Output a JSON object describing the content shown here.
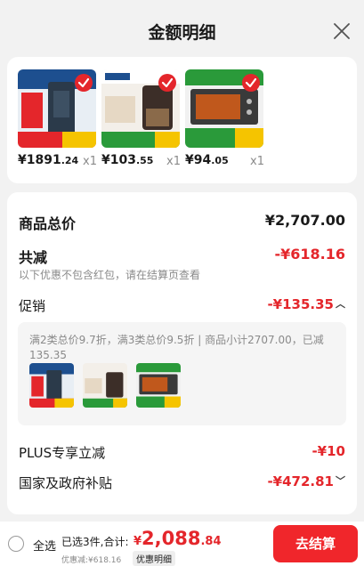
{
  "header": {
    "title": "金额明细"
  },
  "products": [
    {
      "price_int": "¥1891",
      "price_dec": ".24",
      "qty": "x1",
      "thumb_color": "#2b3a4a"
    },
    {
      "price_int": "¥103",
      "price_dec": ".55",
      "qty": "x1",
      "thumb_color": "#3c2e28"
    },
    {
      "price_int": "¥94",
      "price_dec": ".05",
      "qty": "x1",
      "thumb_color": "#3a3a3a"
    }
  ],
  "summary": {
    "total_label": "商品总价",
    "total_value": "¥2,707.00",
    "reduce_label": "共减",
    "reduce_value": "-¥618.16",
    "reduce_note": "以下优惠不包含红包，请在结算页查看",
    "promo_label": "促销",
    "promo_value": "-¥135.35",
    "promo_text": "满2类总价9.7折，满3类总价9.5折 | 商品小计2707.00，已减135.35",
    "plus_label": "PLUS专享立减",
    "plus_value": "-¥10",
    "gov_label": "国家及政府补贴",
    "gov_value": "-¥472.81"
  },
  "bottom": {
    "select_all": "全选",
    "selected_text": "已选3件,合计:",
    "total_cur": "¥",
    "total_int": "2,088",
    "total_dec": ".84",
    "discount_text": "优惠减:¥618.16",
    "detail_link": "优惠明细",
    "checkout_label": "去结算"
  },
  "colors": {
    "accent": "#e4262b",
    "checkout_bg": "#f0262b"
  }
}
